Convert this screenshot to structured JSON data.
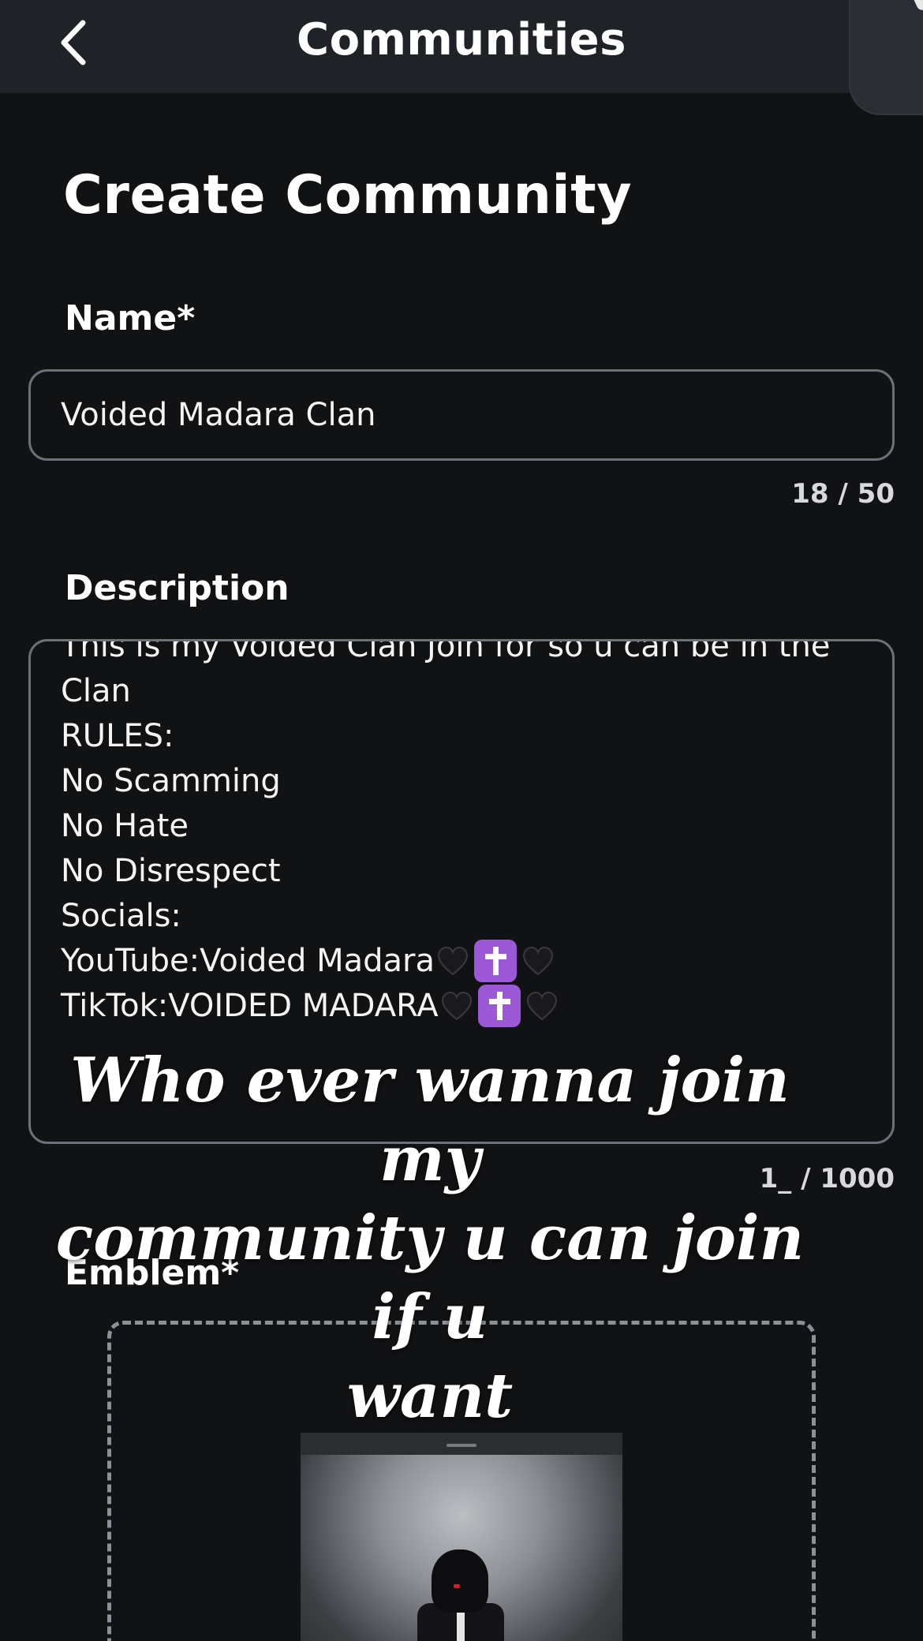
{
  "header": {
    "title": "Communities",
    "back_icon": "chevron-left-icon"
  },
  "form": {
    "heading": "Create Community",
    "name": {
      "label": "Name*",
      "value": "Voided Madara Clan",
      "counter": "18 / 50"
    },
    "description": {
      "label": "Description",
      "lines": [
        "This is my Voided Clan Join for so u can be in the",
        "Clan",
        "RULES:",
        "No Scamming",
        "No Hate",
        "No Disrespect",
        "Socials:",
        "YouTube:Voided Madara",
        "TikTok:VOIDED MADARA"
      ],
      "social_emoji": [
        "black-heart-icon",
        "latin-cross-icon",
        "black-heart-icon"
      ],
      "counter": "1_ / 1000"
    },
    "emblem": {
      "label": "Emblem*"
    }
  },
  "overlay_caption": {
    "line1": "Who ever wanna join my",
    "line2": "community u can join if u",
    "line3": "want"
  },
  "colors": {
    "background": "#111214",
    "header_bg": "#1f2227",
    "field_border": "#6d7079",
    "cross_emoji": "#9b59d6"
  }
}
